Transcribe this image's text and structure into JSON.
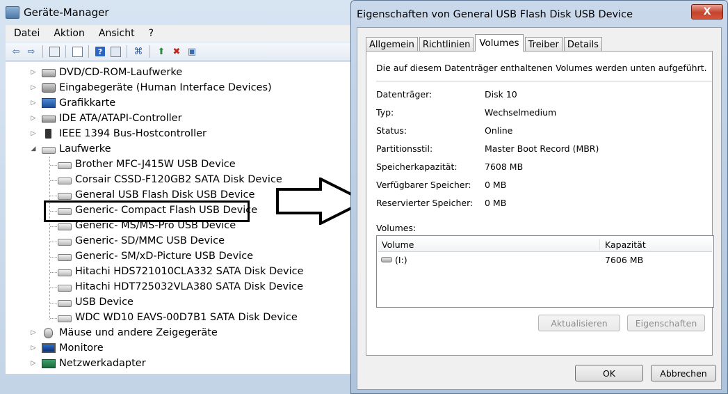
{
  "device_manager": {
    "title": "Geräte-Manager",
    "menu": [
      "Datei",
      "Aktion",
      "Ansicht",
      "?"
    ],
    "tree": [
      {
        "label": "DVD/CD-ROM-Laufwerke",
        "icon": "dvd-drive-icon",
        "expanded": false
      },
      {
        "label": "Eingabegeräte (Human Interface Devices)",
        "icon": "hid-icon",
        "expanded": false
      },
      {
        "label": "Grafikkarte",
        "icon": "display-adapter-icon",
        "expanded": false
      },
      {
        "label": "IDE ATA/ATAPI-Controller",
        "icon": "ide-controller-icon",
        "expanded": false
      },
      {
        "label": "IEEE 1394 Bus-Hostcontroller",
        "icon": "firewire-icon",
        "expanded": false
      },
      {
        "label": "Laufwerke",
        "icon": "disk-drive-icon",
        "expanded": true,
        "children": [
          "Brother MFC-J415W USB Device",
          "Corsair CSSD-F120GB2 SATA Disk Device",
          "General USB Flash Disk USB Device",
          "Generic- Compact Flash USB Device",
          "Generic- MS/MS-Pro USB Device",
          "Generic- SD/MMC USB Device",
          "Generic- SM/xD-Picture USB Device",
          "Hitachi HDS721010CLA332 SATA Disk Device",
          "Hitachi HDT725032VLA380 SATA Disk Device",
          "USB Device",
          "WDC WD10 EAVS-00D7B1 SATA Disk Device"
        ]
      },
      {
        "label": "Mäuse und andere Zeigegeräte",
        "icon": "mouse-icon",
        "expanded": false
      },
      {
        "label": "Monitore",
        "icon": "monitor-icon",
        "expanded": false
      },
      {
        "label": "Netzwerkadapter",
        "icon": "network-adapter-icon",
        "expanded": false
      }
    ],
    "highlighted_device": "Generic- Compact Flash USB Device"
  },
  "dialog": {
    "title": "Eigenschaften von General USB Flash Disk USB Device",
    "close_label": "X",
    "tabs": [
      "Allgemein",
      "Richtlinien",
      "Volumes",
      "Treiber",
      "Details"
    ],
    "active_tab": "Volumes",
    "description": "Die auf diesem Datenträger enthaltenen Volumes werden unten aufgeführt.",
    "properties": [
      {
        "label": "Datenträger:",
        "value": "Disk 10"
      },
      {
        "label": "Typ:",
        "value": "Wechselmedium"
      },
      {
        "label": "Status:",
        "value": "Online"
      },
      {
        "label": "Partitionsstil:",
        "value": "Master Boot Record (MBR)"
      },
      {
        "label": "Speicherkapazität:",
        "value": "7608 MB"
      },
      {
        "label": "Verfügbarer Speicher:",
        "value": "0 MB"
      },
      {
        "label": "Reservierter Speicher:",
        "value": "0 MB"
      }
    ],
    "volumes_label": "Volumes:",
    "volume_columns": [
      "Volume",
      "Kapazität"
    ],
    "volumes": [
      {
        "name": "(I:)",
        "capacity": "7606 MB"
      }
    ],
    "buttons": {
      "refresh": "Aktualisieren",
      "properties": "Eigenschaften",
      "ok": "OK",
      "cancel": "Abbrechen"
    }
  }
}
